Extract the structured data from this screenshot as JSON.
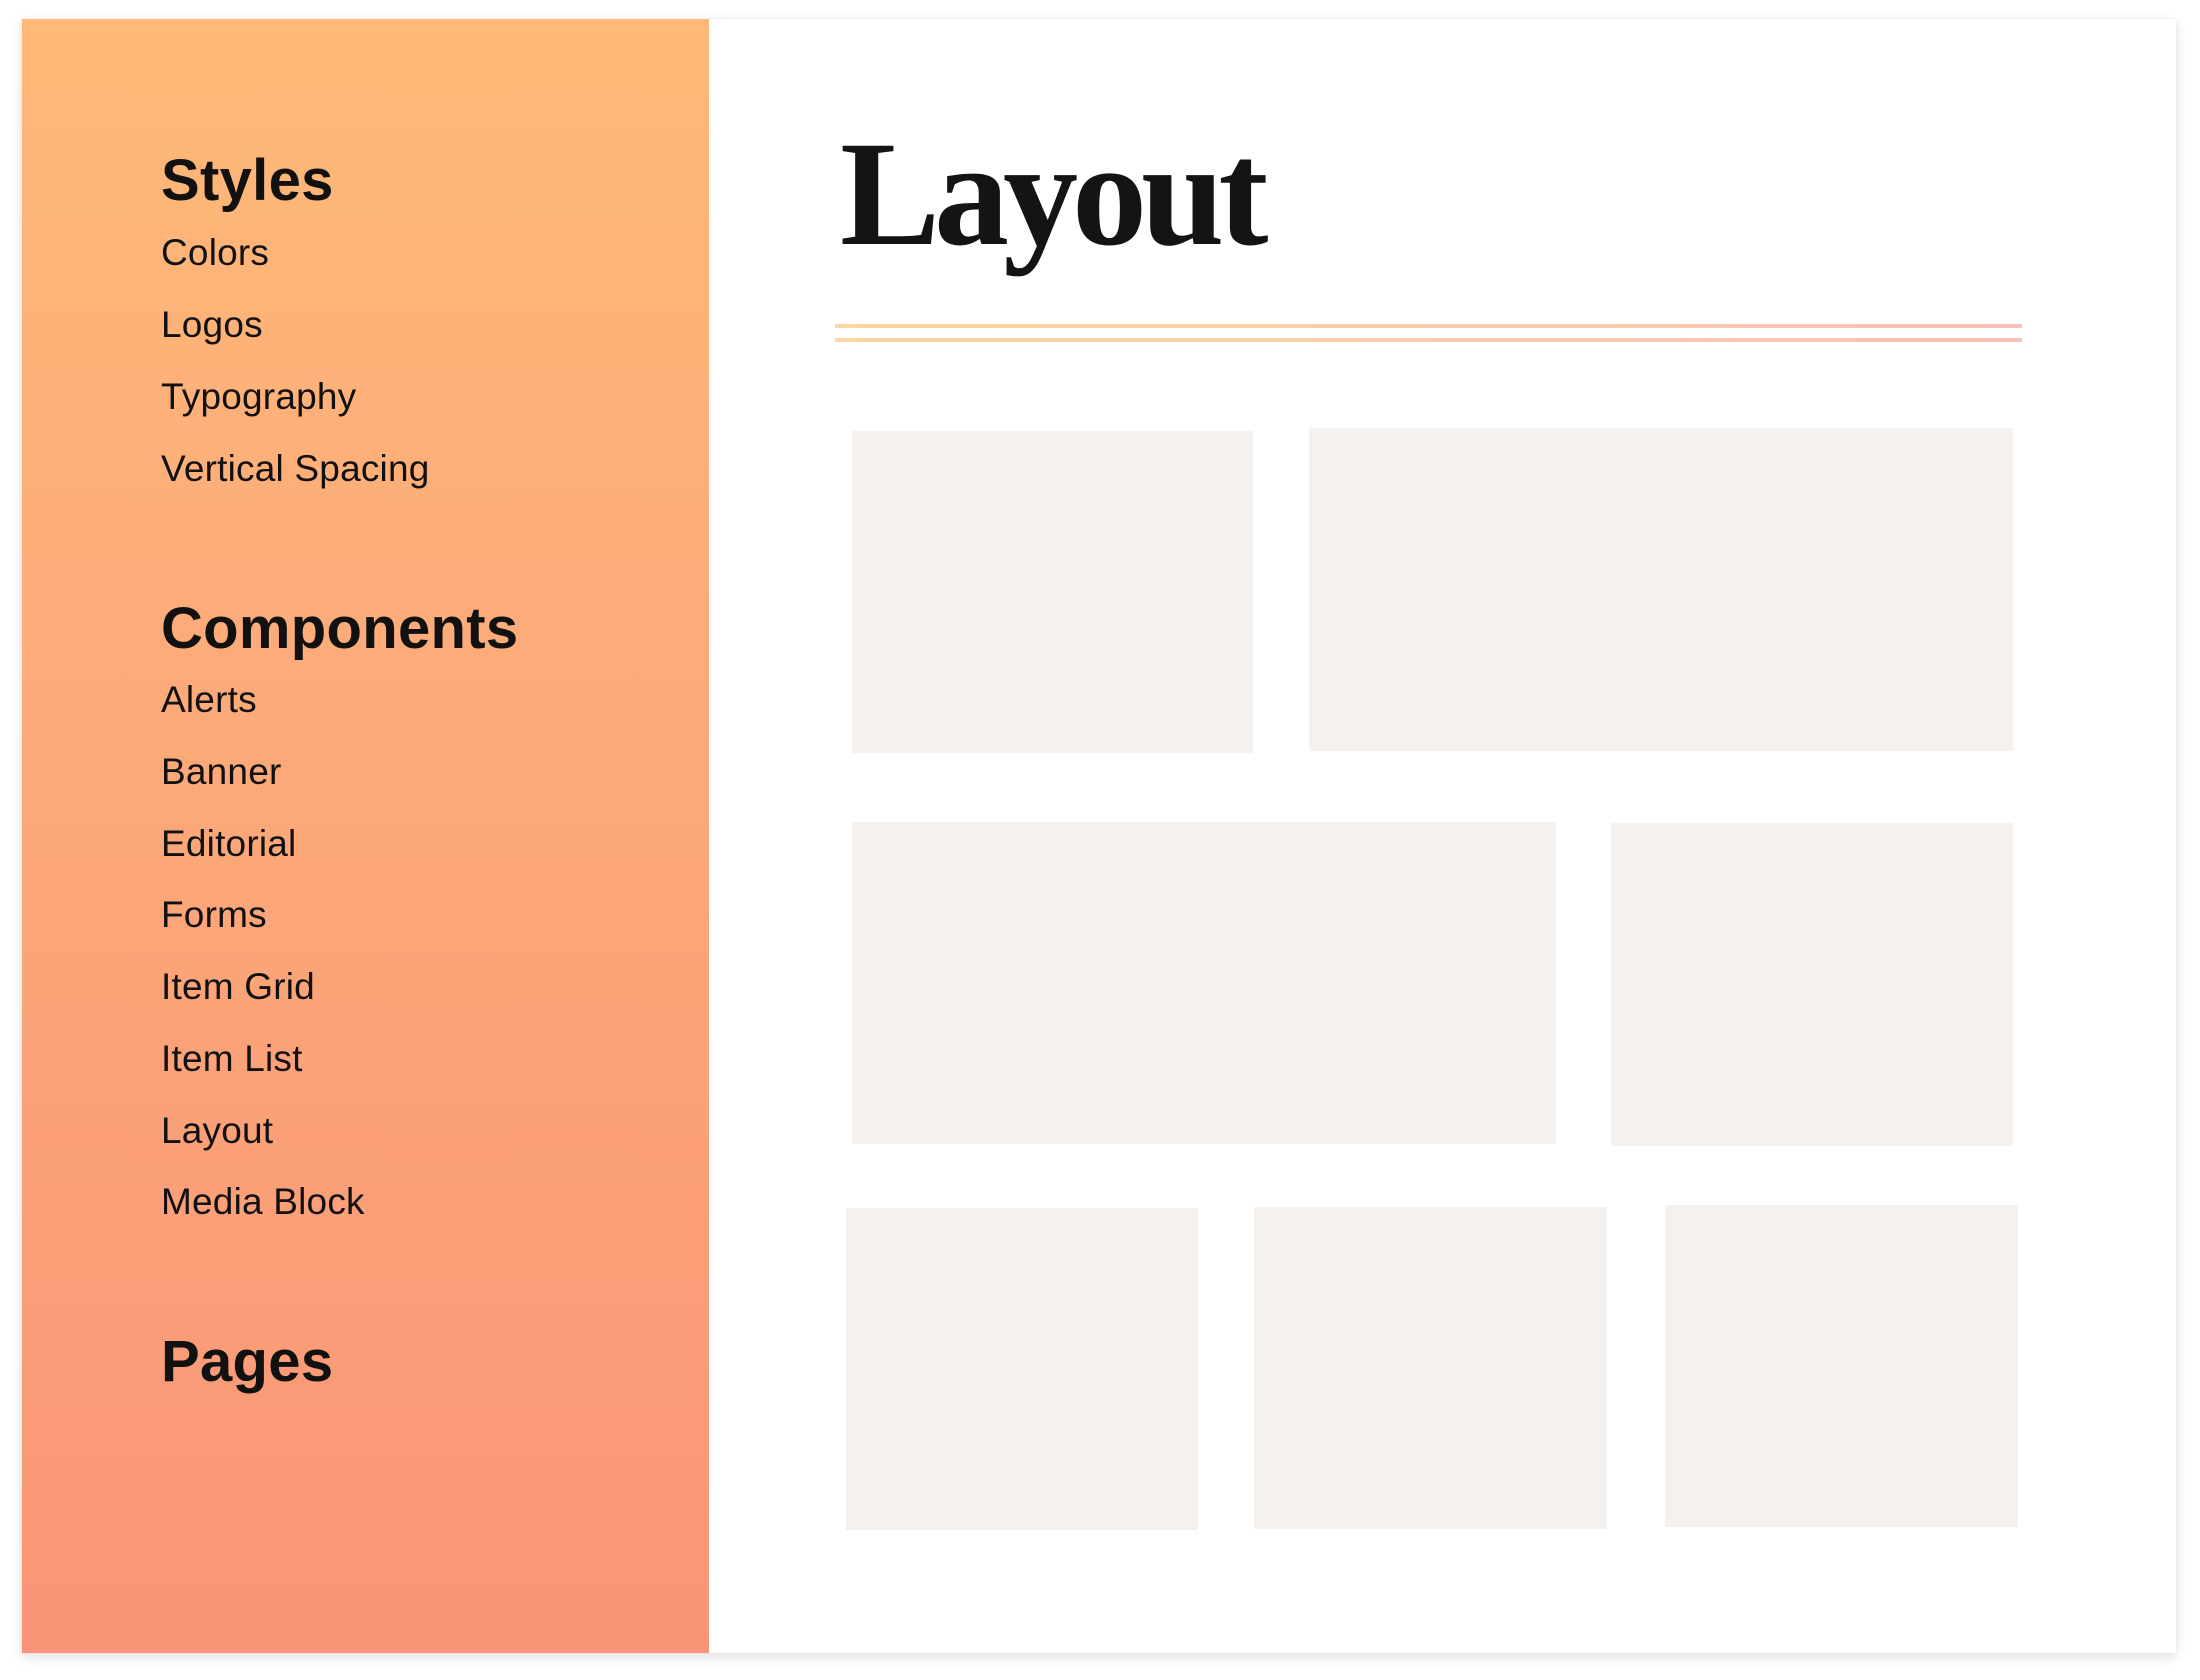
{
  "sidebar": {
    "sections": [
      {
        "heading": "Styles",
        "items": [
          "Colors",
          "Logos",
          "Typography",
          "Vertical Spacing"
        ]
      },
      {
        "heading": "Components",
        "items": [
          "Alerts",
          "Banner",
          "Editorial",
          "Forms",
          "Item Grid",
          "Item List",
          "Layout",
          "Media Block"
        ]
      },
      {
        "heading": "Pages",
        "items": []
      }
    ],
    "colors": {
      "gradient_top": "#FFB978",
      "gradient_bottom": "#F99577"
    }
  },
  "main": {
    "title": "Layout",
    "divider_colors": {
      "start": "#FDD5A0",
      "end": "#F6C2B4"
    },
    "placeholder_color": "#F5F1EE",
    "placeholder_block_count": 7
  }
}
